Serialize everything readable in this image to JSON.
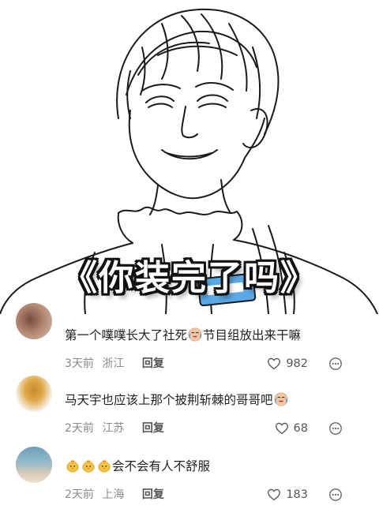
{
  "illustration": {
    "title": "《你装完了吗》"
  },
  "comments": [
    {
      "text_before_emoji": "第一个噗噗长大了社死",
      "text_after_emoji": "节目组放出来干嘛",
      "time": "3天前",
      "location": "浙江",
      "reply_label": "回复",
      "likes": "982"
    },
    {
      "text_before_emoji": "马天宇也应该上那个披荆斩棘的哥哥吧",
      "text_after_emoji": "",
      "time": "2天前",
      "location": "江苏",
      "reply_label": "回复",
      "likes": "68"
    },
    {
      "text_before_emoji": "",
      "text_after_emoji": "会不会有人不舒服",
      "time": "2天前",
      "location": "上海",
      "reply_label": "回复",
      "likes": "183"
    }
  ],
  "colors": {
    "text_primary": "#1f1f1f",
    "text_meta": "#8a8a8a",
    "reply": "#555555",
    "emoji_face": "#f6c9a5",
    "chick_yellow": "#f6c443"
  },
  "icons": [
    "crying-laughing-emoji",
    "chick-emoji",
    "heart-icon",
    "more-dots-icon"
  ]
}
